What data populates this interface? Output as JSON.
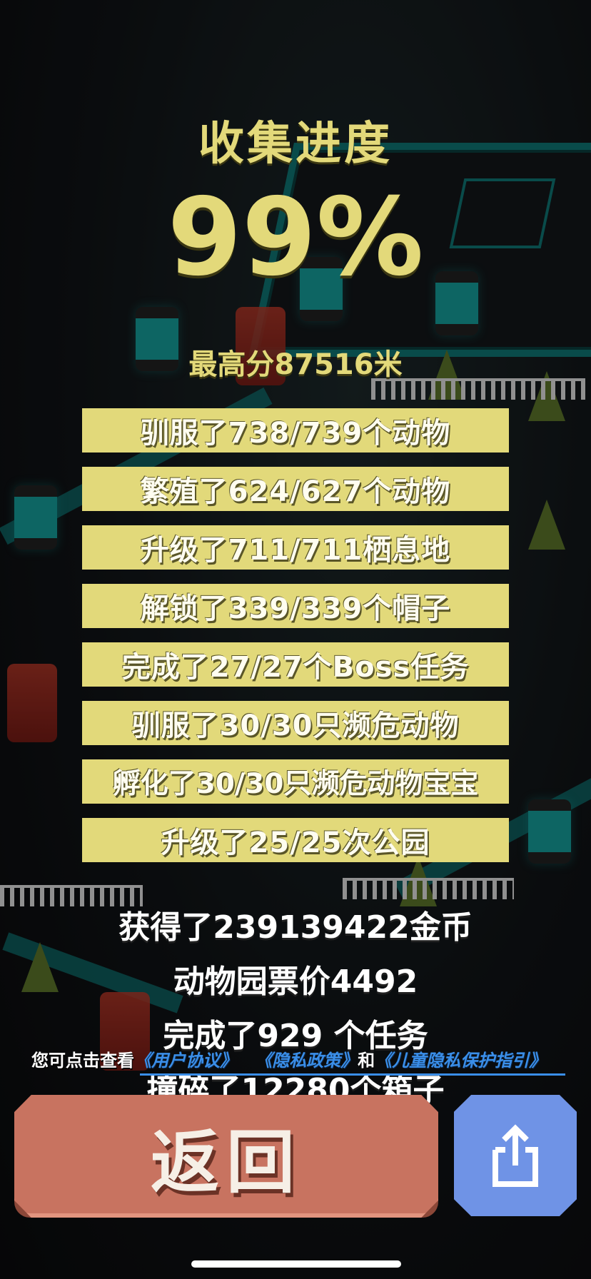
{
  "title": "收集进度",
  "progress_percent_label": "99%",
  "progress_value": 0.99,
  "high_score": "最高分87516米",
  "stat_bars": [
    "驯服了738/739个动物",
    "繁殖了624/627个动物",
    "升级了711/711栖息地",
    "解锁了339/339个帽子",
    "完成了27/27个Boss任务",
    "驯服了30/30只濒危动物",
    "孵化了30/30只濒危动物宝宝",
    "升级了25/25次公园"
  ],
  "white_stats": [
    "获得了239139422金币",
    "动物园票价4492",
    "完成了929 个任务",
    "撞碎了12280个箱子"
  ],
  "legal": {
    "prefix": "您可点击查看",
    "user_agreement": "《用户协议》",
    "privacy_policy": "《隐私政策》",
    "and": "和",
    "child_privacy": "《儿童隐私保护指引》"
  },
  "buttons": {
    "back_label": "返回",
    "share_icon": "share-upload-icon"
  },
  "colors": {
    "title_yellow": "#e3d97a",
    "bar_fill": "#e2d97a",
    "back_button": "#c87360",
    "share_button": "#6f93e6",
    "link_blue": "#3a8ee8"
  }
}
